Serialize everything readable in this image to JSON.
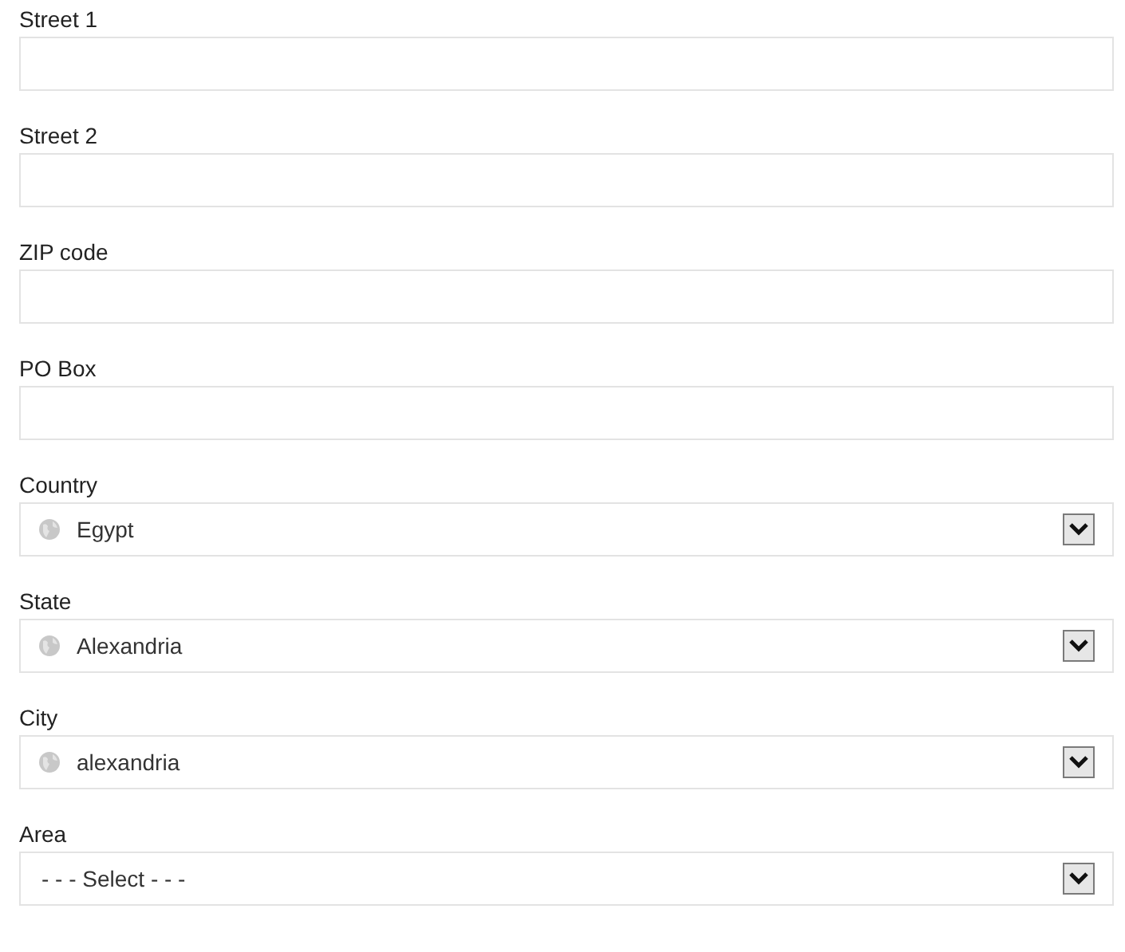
{
  "fields": [
    {
      "kind": "text",
      "label": "Street 1"
    },
    {
      "kind": "text",
      "label": "Street 2"
    },
    {
      "kind": "text",
      "label": "ZIP code"
    },
    {
      "kind": "text",
      "label": "PO Box"
    },
    {
      "kind": "select",
      "label": "Country",
      "value": "Egypt",
      "show_icon": true
    },
    {
      "kind": "select",
      "label": "State",
      "value": "Alexandria",
      "show_icon": true
    },
    {
      "kind": "select",
      "label": "City",
      "value": "alexandria",
      "show_icon": true
    },
    {
      "kind": "select",
      "label": "Area",
      "value": "- - - Select - - -",
      "show_icon": false
    }
  ]
}
